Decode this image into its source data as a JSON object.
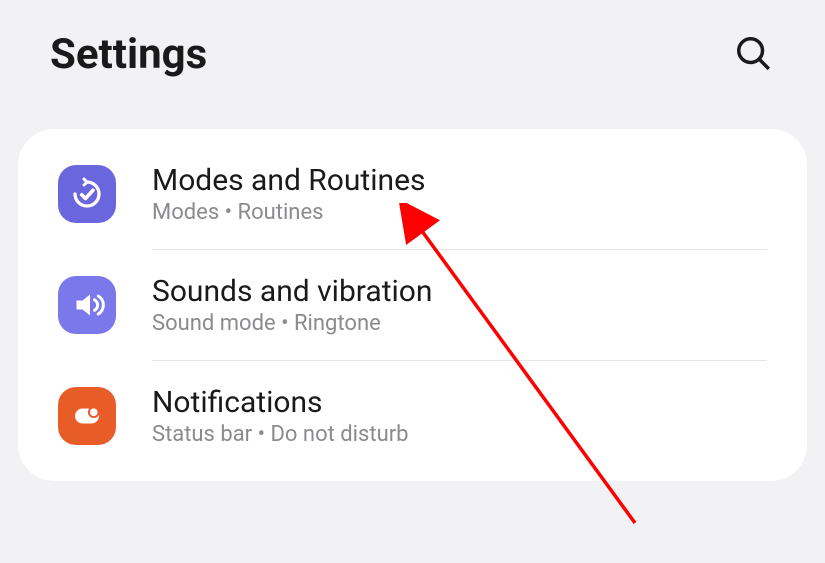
{
  "header": {
    "title": "Settings"
  },
  "items": [
    {
      "title": "Modes and Routines",
      "subtitle": "Modes  •  Routines"
    },
    {
      "title": "Sounds and vibration",
      "subtitle": "Sound mode  •  Ringtone"
    },
    {
      "title": "Notifications",
      "subtitle": "Status bar  •  Do not disturb"
    }
  ]
}
